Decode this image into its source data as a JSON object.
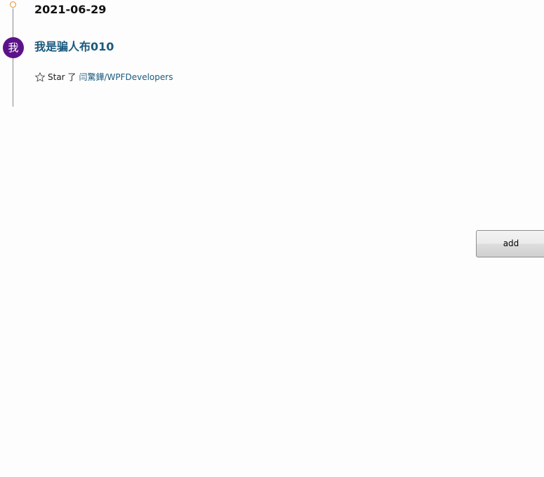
{
  "timeline": {
    "date": "2021-06-29",
    "entries": [
      {
        "avatar_char": "我",
        "username": "我是骗人布010",
        "icon": "star-outline-icon",
        "verb": "Star 了",
        "repo": "闫驚鏵/WPFDevelopers"
      }
    ]
  },
  "actions": {
    "add_label": "add"
  },
  "colors": {
    "timeline_dot": "#f08a24",
    "avatar_bg": "#5c1389",
    "link": "#1b5a7e",
    "timeline_line": "#8a8a8a"
  }
}
